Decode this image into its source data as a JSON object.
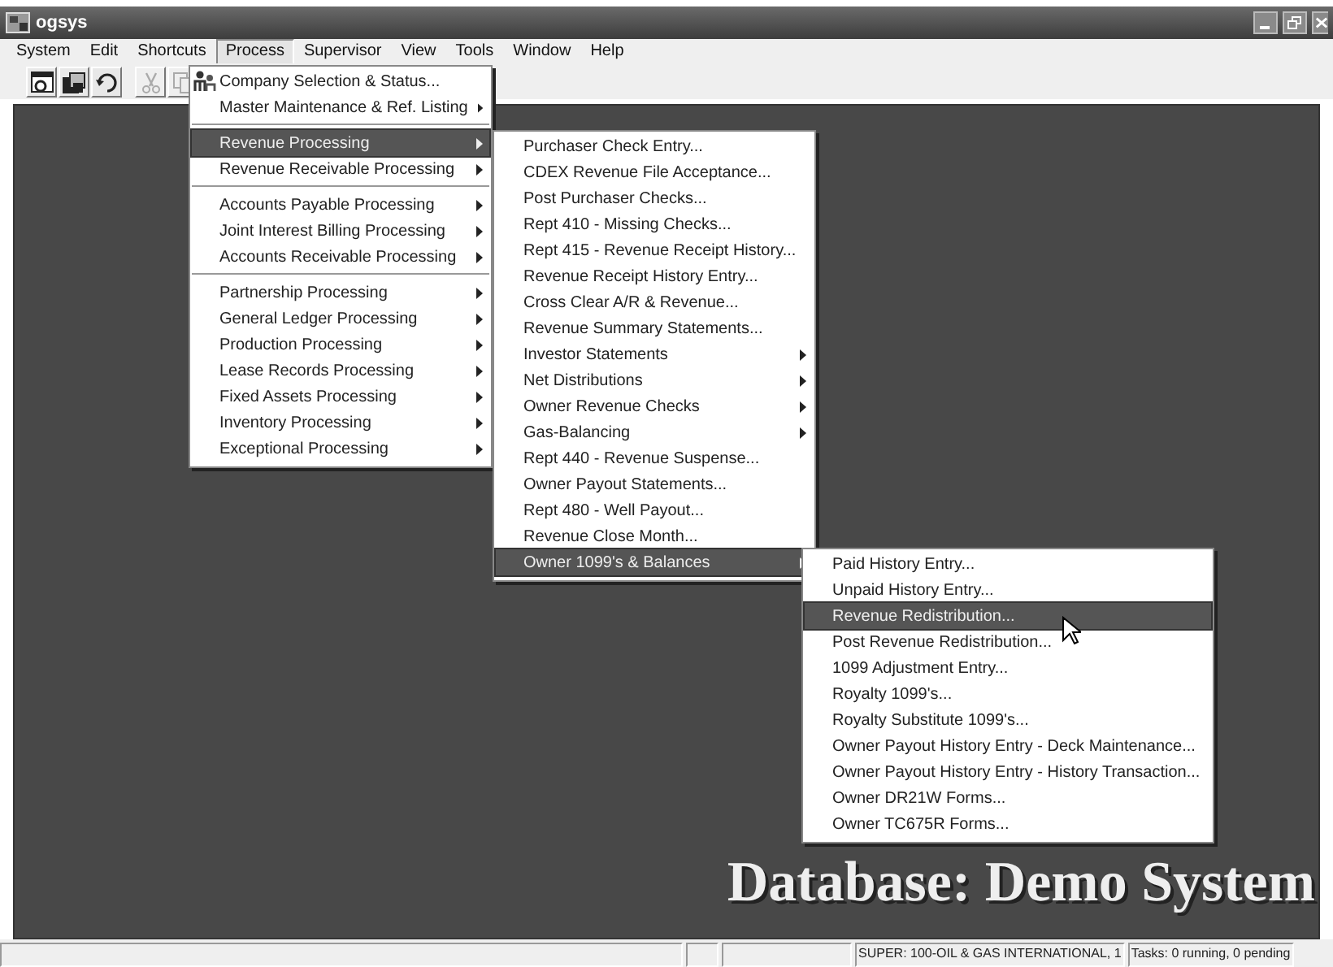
{
  "window": {
    "title": "ogsys"
  },
  "menubar": [
    {
      "label": "System",
      "open": false
    },
    {
      "label": "Edit",
      "open": false
    },
    {
      "label": "Shortcuts",
      "open": false
    },
    {
      "label": "Process",
      "open": true
    },
    {
      "label": "Supervisor",
      "open": false
    },
    {
      "label": "View",
      "open": false
    },
    {
      "label": "Tools",
      "open": false
    },
    {
      "label": "Window",
      "open": false
    },
    {
      "label": "Help",
      "open": false
    }
  ],
  "toolbar": [
    {
      "kind": "window",
      "disabled": false
    },
    {
      "kind": "stack",
      "disabled": false
    },
    {
      "kind": "undo",
      "disabled": false
    },
    {
      "kind": "cut",
      "disabled": true
    },
    {
      "kind": "copy",
      "disabled": true
    }
  ],
  "menus": [
    {
      "items": [
        {
          "kind": "icon_item",
          "label": "Company Selection & Status...",
          "submenu": false,
          "selected": false
        },
        {
          "kind": "item",
          "label": "Master Maintenance & Ref. Listing",
          "submenu": true,
          "selected": false
        },
        {
          "kind": "separator"
        },
        {
          "kind": "item",
          "label": "Revenue Processing",
          "submenu": true,
          "selected": true
        },
        {
          "kind": "item",
          "label": "Revenue Receivable Processing",
          "submenu": true,
          "selected": false
        },
        {
          "kind": "separator"
        },
        {
          "kind": "item",
          "label": "Accounts Payable Processing",
          "submenu": true,
          "selected": false
        },
        {
          "kind": "item",
          "label": "Joint Interest Billing Processing",
          "submenu": true,
          "selected": false
        },
        {
          "kind": "item",
          "label": "Accounts Receivable Processing",
          "submenu": true,
          "selected": false
        },
        {
          "kind": "separator"
        },
        {
          "kind": "item",
          "label": "Partnership Processing",
          "submenu": true,
          "selected": false
        },
        {
          "kind": "item",
          "label": "General Ledger Processing",
          "submenu": true,
          "selected": false
        },
        {
          "kind": "item",
          "label": "Production Processing",
          "submenu": true,
          "selected": false
        },
        {
          "kind": "item",
          "label": "Lease Records Processing",
          "submenu": true,
          "selected": false
        },
        {
          "kind": "item",
          "label": "Fixed Assets Processing",
          "submenu": true,
          "selected": false
        },
        {
          "kind": "item",
          "label": "Inventory Processing",
          "submenu": true,
          "selected": false
        },
        {
          "kind": "item",
          "label": "Exceptional Processing",
          "submenu": true,
          "selected": false
        }
      ]
    },
    {
      "items": [
        {
          "kind": "item",
          "label": "Purchaser Check Entry...",
          "submenu": false,
          "selected": false
        },
        {
          "kind": "item",
          "label": "CDEX Revenue File Acceptance...",
          "submenu": false,
          "selected": false
        },
        {
          "kind": "item",
          "label": "Post Purchaser Checks...",
          "submenu": false,
          "selected": false
        },
        {
          "kind": "item",
          "label": "Rept 410 - Missing Checks...",
          "submenu": false,
          "selected": false
        },
        {
          "kind": "item",
          "label": "Rept 415 - Revenue Receipt History...",
          "submenu": false,
          "selected": false
        },
        {
          "kind": "item",
          "label": "Revenue Receipt History Entry...",
          "submenu": false,
          "selected": false
        },
        {
          "kind": "item",
          "label": "Cross Clear A/R & Revenue...",
          "submenu": false,
          "selected": false
        },
        {
          "kind": "item",
          "label": "Revenue Summary Statements...",
          "submenu": false,
          "selected": false
        },
        {
          "kind": "item",
          "label": "Investor Statements",
          "submenu": true,
          "selected": false
        },
        {
          "kind": "item",
          "label": "Net Distributions",
          "submenu": true,
          "selected": false
        },
        {
          "kind": "item",
          "label": "Owner Revenue Checks",
          "submenu": true,
          "selected": false
        },
        {
          "kind": "item",
          "label": "Gas-Balancing",
          "submenu": true,
          "selected": false
        },
        {
          "kind": "item",
          "label": "Rept 440 - Revenue Suspense...",
          "submenu": false,
          "selected": false
        },
        {
          "kind": "item",
          "label": "Owner Payout Statements...",
          "submenu": false,
          "selected": false
        },
        {
          "kind": "item",
          "label": "Rept 480 - Well Payout...",
          "submenu": false,
          "selected": false
        },
        {
          "kind": "item",
          "label": "Revenue Close Month...",
          "submenu": false,
          "selected": false
        },
        {
          "kind": "item",
          "label": "Owner 1099's & Balances",
          "submenu": true,
          "selected": true
        }
      ]
    },
    {
      "items": [
        {
          "kind": "item",
          "label": "Paid History Entry...",
          "submenu": false,
          "selected": false
        },
        {
          "kind": "item",
          "label": "Unpaid History Entry...",
          "submenu": false,
          "selected": false
        },
        {
          "kind": "item",
          "label": "Revenue Redistribution...",
          "submenu": false,
          "selected": true
        },
        {
          "kind": "item",
          "label": "Post Revenue Redistribution...",
          "submenu": false,
          "selected": false
        },
        {
          "kind": "item",
          "label": "1099 Adjustment Entry...",
          "submenu": false,
          "selected": false
        },
        {
          "kind": "item",
          "label": "Royalty 1099's...",
          "submenu": false,
          "selected": false
        },
        {
          "kind": "item",
          "label": "Royalty Substitute 1099's...",
          "submenu": false,
          "selected": false
        },
        {
          "kind": "item",
          "label": "Owner Payout History Entry - Deck Maintenance...",
          "submenu": false,
          "selected": false
        },
        {
          "kind": "item",
          "label": "Owner Payout History Entry - History Transaction...",
          "submenu": false,
          "selected": false
        },
        {
          "kind": "item",
          "label": "Owner DR21W Forms...",
          "submenu": false,
          "selected": false
        },
        {
          "kind": "item",
          "label": "Owner TC675R Forms...",
          "submenu": false,
          "selected": false
        }
      ]
    }
  ],
  "banner": "Database: Demo System",
  "status_bar": {
    "panes": [
      "SUPER: 100-OIL & GAS INTERNATIONAL, 1",
      "Tasks: 0 running, 0 pending"
    ]
  }
}
